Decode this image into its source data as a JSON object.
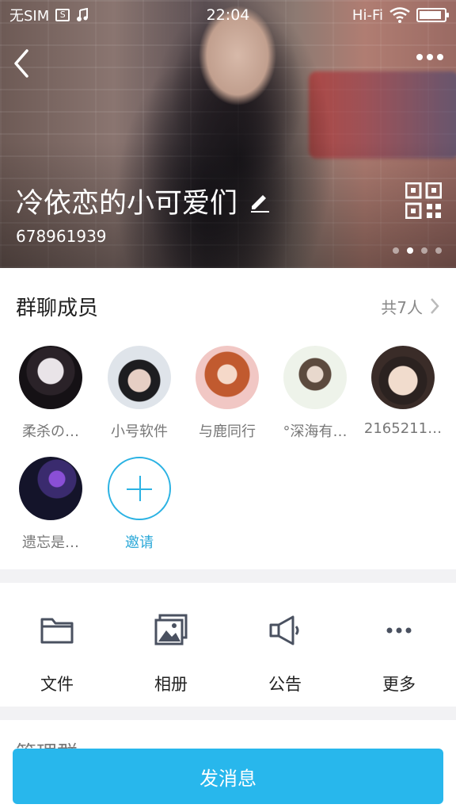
{
  "status_bar": {
    "carrier": "无SIM",
    "time": "22:04",
    "network": "Hi-Fi",
    "battery_level": 0.9
  },
  "header": {
    "group_name": "冷依恋的小可爱们",
    "group_id": "678961939",
    "photo_pages": 4,
    "active_page": 2
  },
  "members": {
    "title": "群聊成员",
    "count_label": "共7人",
    "items": [
      {
        "name": "柔杀の…",
        "avatar": "dark-hoodie-person"
      },
      {
        "name": "小号软件",
        "avatar": "boy-with-microphone"
      },
      {
        "name": "与鹿同行",
        "avatar": "anime-girl"
      },
      {
        "name": "°深海有…",
        "avatar": "girl-white-background"
      },
      {
        "name": "2165211…",
        "avatar": "girl-close-up"
      },
      {
        "name": "遗忘是…",
        "avatar": "purple-light-silhouette"
      }
    ],
    "invite_label": "邀请"
  },
  "functions": [
    {
      "label": "文件",
      "icon": "folder-icon"
    },
    {
      "label": "相册",
      "icon": "album-icon"
    },
    {
      "label": "公告",
      "icon": "megaphone-icon"
    },
    {
      "label": "更多",
      "icon": "more-icon"
    }
  ],
  "partial_section": {
    "label": "管理群"
  },
  "send_button": {
    "label": "发消息"
  },
  "colors": {
    "accent": "#28b7ec",
    "invite": "#2bb2e3"
  }
}
